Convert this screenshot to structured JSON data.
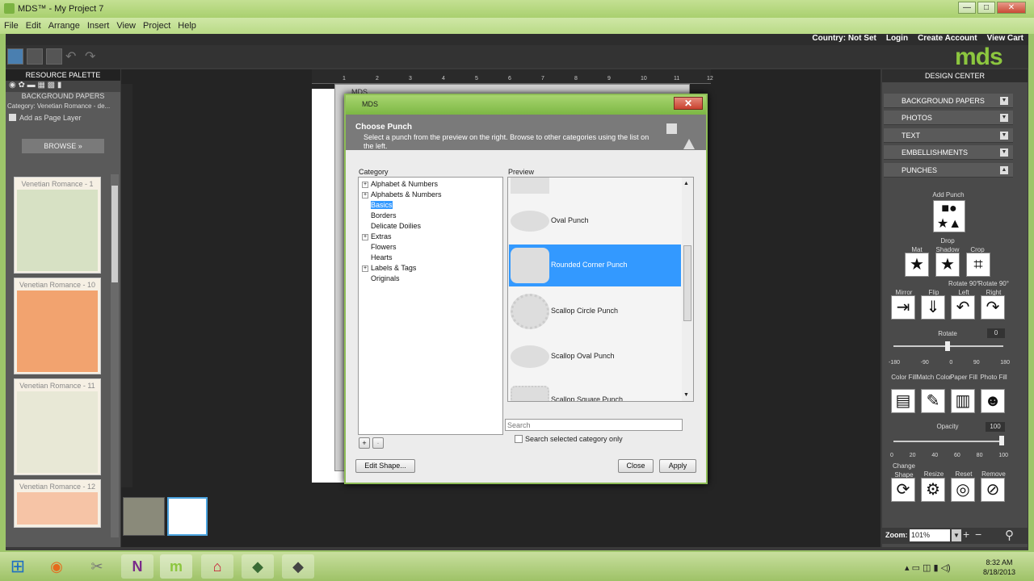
{
  "window": {
    "title": "MDS™ - My Project 7",
    "min": "—",
    "max": "□",
    "close": "✕"
  },
  "menu": [
    "File",
    "Edit",
    "Arrange",
    "Insert",
    "View",
    "Project",
    "Help"
  ],
  "top_links": {
    "country": "Country: Not Set",
    "login": "Login",
    "create_account": "Create Account",
    "view_cart": "View Cart"
  },
  "logo": "mds",
  "resource_palette": {
    "title": "RESOURCE PALETTE",
    "section": "BACKGROUND PAPERS",
    "category": "Category: Venetian Romance - de...",
    "add_as_page_layer": "Add as Page Layer",
    "browse": "BROWSE »",
    "items": [
      {
        "label": "Venetian Romance - 1",
        "color": "#d7e1c4"
      },
      {
        "label": "Venetian Romance - 10",
        "color": "#f2a36f"
      },
      {
        "label": "Venetian Romance - 11",
        "color": "#e8e8d6"
      },
      {
        "label": "Venetian Romance - 12",
        "color": "#f6c4a6"
      }
    ]
  },
  "ruler_marks": [
    "1",
    "2",
    "3",
    "4",
    "5",
    "6",
    "7",
    "8",
    "9",
    "10",
    "11",
    "12"
  ],
  "behind_dialog_title": "MDS",
  "dialog": {
    "title": "MDS",
    "close": "✕",
    "heading": "Choose Punch",
    "description": "Select a punch from the preview on the right. Browse to other categories using the list on the left.",
    "category_label": "Category",
    "preview_label": "Preview",
    "categories": [
      {
        "label": "Alphabet & Numbers",
        "expandable": true
      },
      {
        "label": "Alphabets & Numbers",
        "expandable": true
      },
      {
        "label": "Basics",
        "expandable": false,
        "selected": true
      },
      {
        "label": "Borders",
        "expandable": false
      },
      {
        "label": "Delicate Doilies",
        "expandable": false
      },
      {
        "label": "Extras",
        "expandable": true
      },
      {
        "label": "Flowers",
        "expandable": false
      },
      {
        "label": "Hearts",
        "expandable": false
      },
      {
        "label": "Labels & Tags",
        "expandable": true
      },
      {
        "label": "Originals",
        "expandable": false
      }
    ],
    "punches": [
      {
        "label": "Oval Punch",
        "shape": "oval"
      },
      {
        "label": "Rounded Corner Punch",
        "shape": "rounded",
        "selected": true
      },
      {
        "label": "Scallop Circle Punch",
        "shape": "scallop-circle"
      },
      {
        "label": "Scallop Oval Punch",
        "shape": "scallop-oval"
      },
      {
        "label": "Scallop Square Punch",
        "shape": "scallop-square"
      }
    ],
    "search_placeholder": "Search",
    "search_selected_only": "Search selected category only",
    "add": "+",
    "remove": "-",
    "edit_shape": "Edit Shape...",
    "close_btn": "Close",
    "apply": "Apply"
  },
  "design_center": {
    "title": "DESIGN CENTER",
    "sections": [
      "BACKGROUND PAPERS",
      "PHOTOS",
      "TEXT",
      "EMBELLISHMENTS",
      "PUNCHES"
    ],
    "add_punch": "Add Punch",
    "tools_row1": [
      {
        "label": "Mat",
        "icon": "star-icon",
        "glyph": "★"
      },
      {
        "label": "Drop Shadow",
        "icon": "shadow-star-icon",
        "glyph": "★"
      },
      {
        "label": "Crop",
        "icon": "crop-icon",
        "glyph": "⌗"
      }
    ],
    "tools_row2": [
      {
        "label": "Mirror",
        "icon": "mirror-icon",
        "glyph": "⇥"
      },
      {
        "label": "Flip",
        "icon": "flip-icon",
        "glyph": "⇓"
      },
      {
        "label": "Rotate 90° Left",
        "icon": "rotate-left-icon",
        "glyph": "↶"
      },
      {
        "label": "Rotate 90° Right",
        "icon": "rotate-right-icon",
        "glyph": "↷"
      }
    ],
    "rotate_label": "Rotate",
    "rotate_value": "0",
    "rotate_ticks": [
      "-180",
      "-90",
      "0",
      "90",
      "180"
    ],
    "tools_row3": [
      {
        "label": "Color Fill",
        "icon": "color-fill-icon",
        "glyph": "▤"
      },
      {
        "label": "Match Color",
        "icon": "eyedropper-icon",
        "glyph": "✎"
      },
      {
        "label": "Paper Fill",
        "icon": "paper-fill-icon",
        "glyph": "▥"
      },
      {
        "label": "Photo Fill",
        "icon": "photo-fill-icon",
        "glyph": "☻"
      }
    ],
    "opacity_label": "Opacity",
    "opacity_value": "100",
    "opacity_ticks": [
      "0",
      "20",
      "40",
      "60",
      "80",
      "100"
    ],
    "tools_row4": [
      {
        "label": "Change Shape",
        "icon": "change-shape-icon",
        "glyph": "⟳"
      },
      {
        "label": "Resize",
        "icon": "resize-icon",
        "glyph": "⚙"
      },
      {
        "label": "Reset",
        "icon": "reset-icon",
        "glyph": "◎"
      },
      {
        "label": "Remove",
        "icon": "remove-icon",
        "glyph": "⊘"
      }
    ],
    "zoom_label": "Zoom:",
    "zoom_value": "101%",
    "zoom_plus": "+",
    "zoom_minus": "−"
  },
  "taskbar": {
    "apps": [
      {
        "icon": "start-orb-icon",
        "glyph": "⊞",
        "color": "#1e6fc2"
      },
      {
        "icon": "firefox-icon",
        "glyph": "◉",
        "color": "#e66a1c"
      },
      {
        "icon": "tools-icon",
        "glyph": "✂",
        "color": "#777"
      },
      {
        "icon": "onenote-icon",
        "glyph": "N",
        "color": "#7a2a8a"
      },
      {
        "icon": "mds-app-icon",
        "glyph": "m",
        "color": "#8cc63f"
      },
      {
        "icon": "acrobat-icon",
        "glyph": "⌂",
        "color": "#c8102e"
      },
      {
        "icon": "app-icon-1",
        "glyph": "◆",
        "color": "#3a6b35"
      },
      {
        "icon": "app-icon-2",
        "glyph": "◆",
        "color": "#444"
      }
    ],
    "time": "8:32 AM",
    "date": "8/18/2013"
  }
}
